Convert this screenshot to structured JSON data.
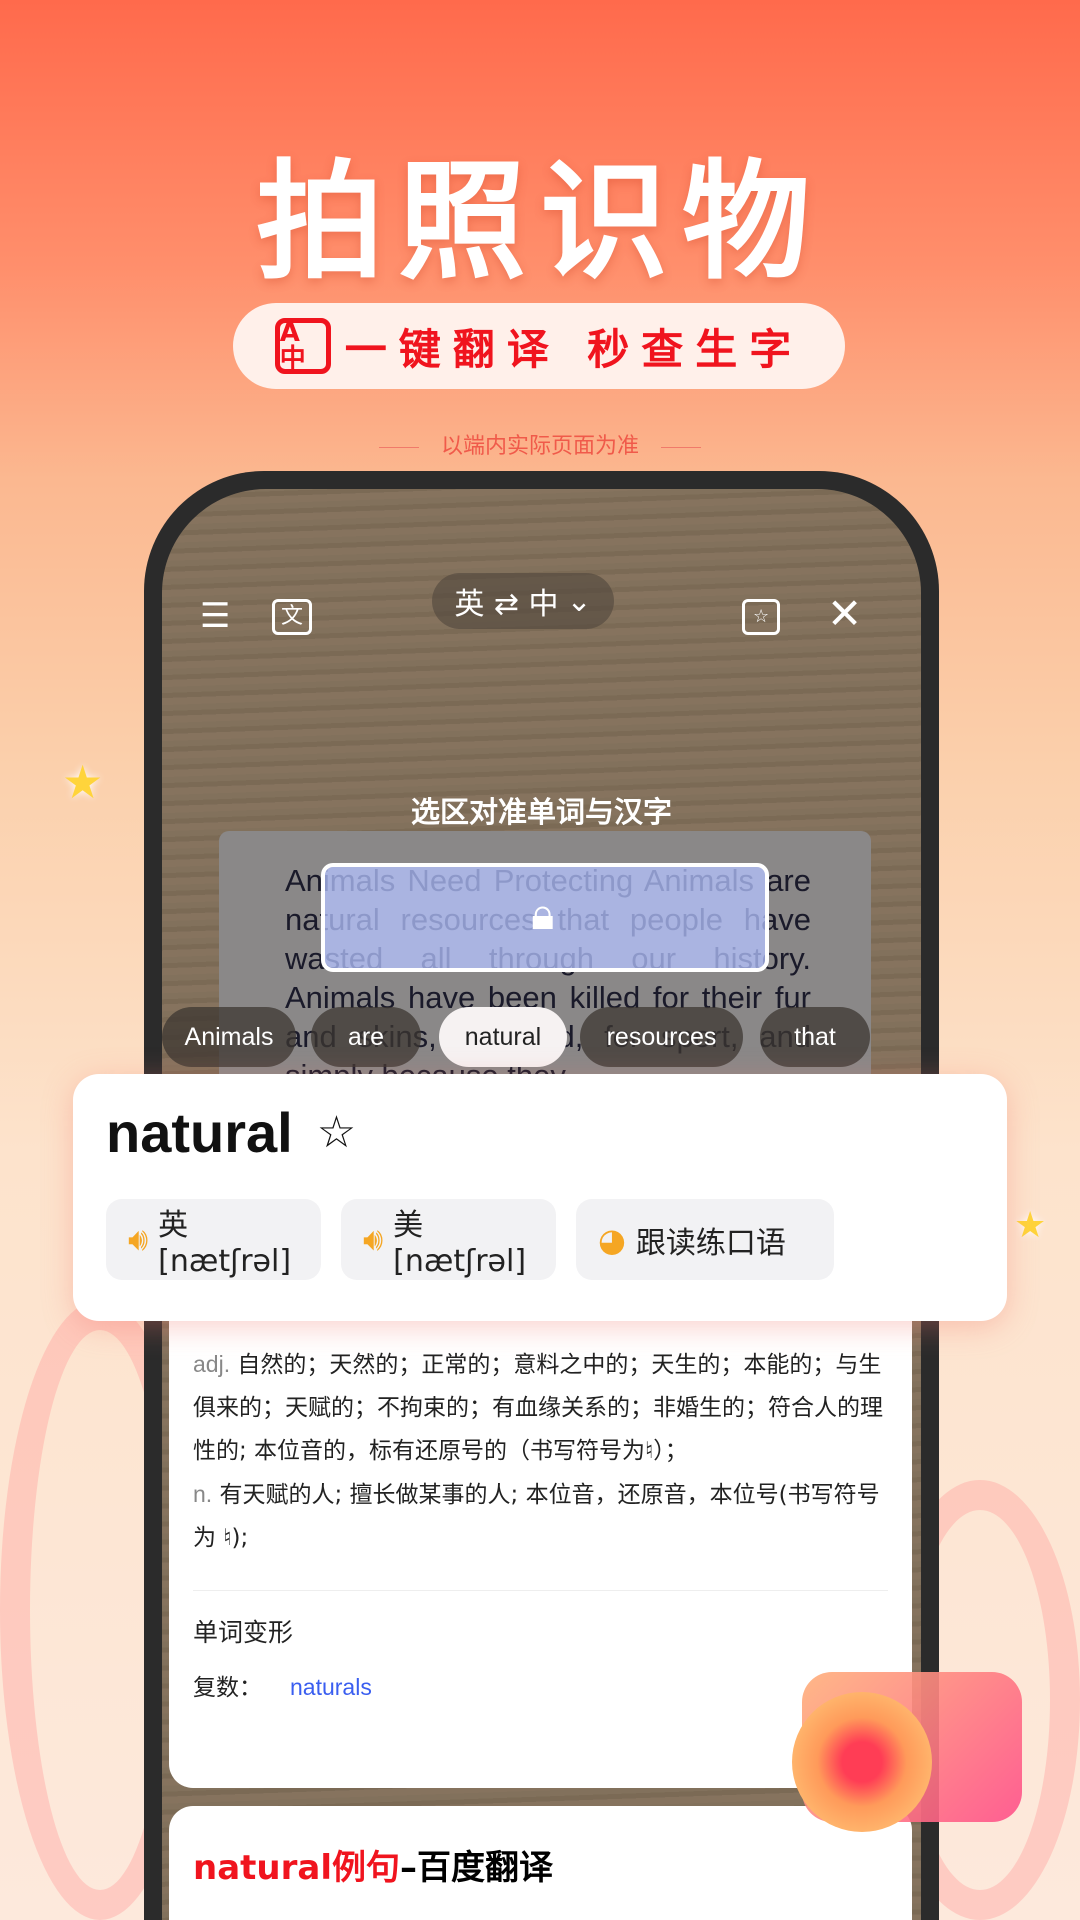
{
  "hero": {
    "title": "拍照识物",
    "subtitle": "一键翻译  秒查生字",
    "subtitle_icon": "translate-scan-icon",
    "note": "以端内实际页面为准"
  },
  "toolbar": {
    "menu_icon": "menu-icon",
    "image_search_icon": "image-translate-icon",
    "language": "英 ⇄ 中",
    "favorites_icon": "wordbook-star-icon",
    "close_icon": "close-icon"
  },
  "camera": {
    "hint": "选区对准单词与汉字",
    "scanned_text": "Animals Need Protecting Animals are natural resources that people have wasted all through our history. Animals have been killed for their fur and skins, for food, for sport, and simply because they",
    "words": [
      "Animals",
      "are",
      "natural",
      "resources",
      "that"
    ],
    "selected_word": "natural"
  },
  "result": {
    "word": "natural",
    "uk": "英[nætʃrəl]",
    "us": "美[nætʃrəl]",
    "practice": "跟读练口语",
    "defs": [
      {
        "pos": "adj.",
        "text": "自然的；天然的；正常的；意料之中的；天生的；本能的；与生俱来的；天赋的；不拘束的；有血缘关系的；非婚生的；符合人的理性的; 本位音的，标有还原号的（书写符号为♮）；"
      },
      {
        "pos": "n.",
        "text": "有天赋的人; 擅长做某事的人; 本位音，还原音，本位号(书写符号为 ♮);"
      }
    ],
    "variants_title": "单词变形",
    "plural_label": "复数：",
    "plural": "naturals",
    "examples_word": "natural例句",
    "examples_suffix": "–百度翻译"
  },
  "colors": {
    "brand_red": "#f0141e",
    "link": "#3a5ef0"
  }
}
